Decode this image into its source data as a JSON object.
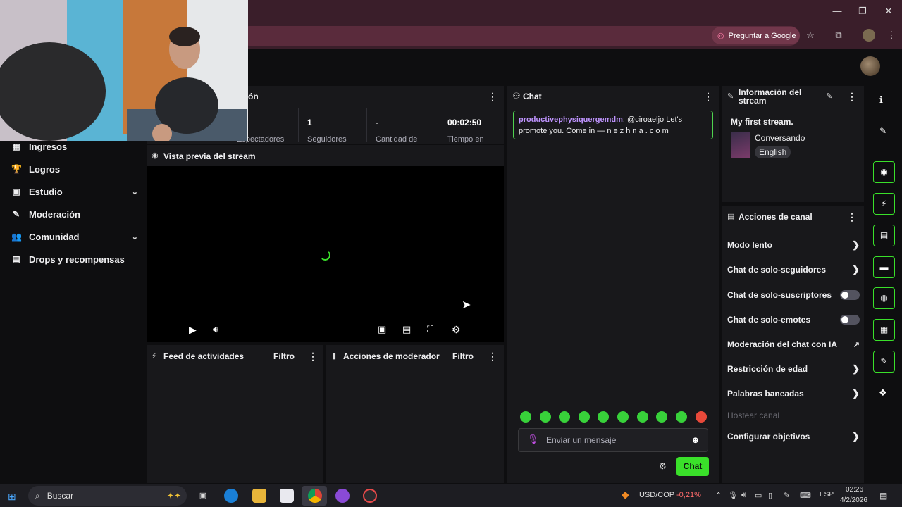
{
  "browser": {
    "ask_google": "Preguntar a Google"
  },
  "sidebar": {
    "items": [
      {
        "label": "Ingresos",
        "icon": "money-icon",
        "chevron": false
      },
      {
        "label": "Logros",
        "icon": "trophy-icon",
        "chevron": false
      },
      {
        "label": "Estudio",
        "icon": "studio-icon",
        "chevron": true
      },
      {
        "label": "Moderación",
        "icon": "wrench-icon",
        "chevron": false
      },
      {
        "label": "Comunidad",
        "icon": "community-icon",
        "chevron": true
      },
      {
        "label": "Drops y recompensas",
        "icon": "drops-icon",
        "chevron": false
      }
    ]
  },
  "stats": {
    "title_fragment": "ón",
    "values": [
      {
        "value": "",
        "label": "Espectadores"
      },
      {
        "value": "1",
        "label": "Seguidores"
      },
      {
        "value": "-",
        "label": "Cantidad de"
      },
      {
        "value": "00:02:50",
        "label": "Tiempo en"
      }
    ],
    "cut_label": "Sesión"
  },
  "preview": {
    "title": "Vista previa del stream"
  },
  "activity_feed": {
    "title": "Feed de actividades",
    "filter": "Filtro"
  },
  "mod_actions": {
    "title": "Acciones de moderador",
    "filter": "Filtro"
  },
  "chat": {
    "title": "Chat",
    "message_user": "productivephysiquergemdm",
    "message_text": ": @ciroaeljo Let's promote you. Come in — n e z h  n a . c o m",
    "input_placeholder": "Enviar un mensaje",
    "send_label": "Chat",
    "user_color": "#bf94ff",
    "accent": "#3ae02a"
  },
  "stream_info": {
    "title": "Información del stream",
    "stream_title": "My first stream.",
    "category": "Conversando",
    "language": "English"
  },
  "channel_actions": {
    "title": "Acciones de canal",
    "items": [
      {
        "label": "Modo lento",
        "control": "chevron"
      },
      {
        "label": "Chat de solo-seguidores",
        "control": "chevron"
      },
      {
        "label": "Chat de solo-suscriptores",
        "control": "toggle"
      },
      {
        "label": "Chat de solo-emotes",
        "control": "toggle"
      },
      {
        "label": "Moderación del chat con IA",
        "control": "external"
      },
      {
        "label": "Restricción de edad",
        "control": "chevron"
      },
      {
        "label": "Palabras baneadas",
        "control": "chevron"
      },
      {
        "label": "Hostear canal",
        "control": "disabled"
      },
      {
        "label": "Configurar objetivos",
        "control": "chevron"
      }
    ]
  },
  "taskbar": {
    "search": "Buscar",
    "ticker": "USD/COP",
    "ticker_change": "-0,21%",
    "lang": "ESP",
    "time": "02:26",
    "date": "4/2/2026"
  }
}
